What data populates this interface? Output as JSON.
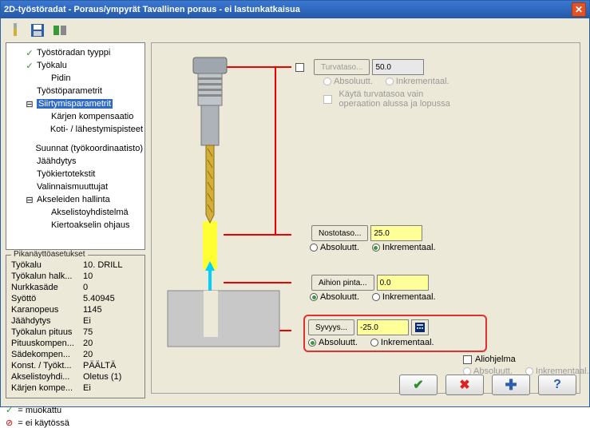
{
  "title": "2D-työstöradat - Poraus/ympyrät Tavallinen poraus - ei lastunkatkaisua",
  "tree": {
    "items": [
      {
        "label": "Työstöradan tyyppi",
        "mark": "green",
        "indent": 1
      },
      {
        "label": "Työkalu",
        "mark": "green",
        "indent": 1
      },
      {
        "label": "Pidin",
        "mark": "",
        "indent": 2
      },
      {
        "label": "Työstöparametrit",
        "mark": "",
        "indent": 1
      },
      {
        "label": "Siirtymisparametrit",
        "mark": "",
        "indent": 1,
        "sel": true
      },
      {
        "label": "Kärjen kompensaatio",
        "mark": "",
        "indent": 2
      },
      {
        "label": "Koti- / lähestymispisteet",
        "mark": "",
        "indent": 2
      },
      {
        "label": "Suunnat (työkoordinaatisto)",
        "mark": "",
        "indent": 1
      },
      {
        "label": "Jäähdytys",
        "mark": "",
        "indent": 1
      },
      {
        "label": "Työkiertotekstit",
        "mark": "",
        "indent": 1
      },
      {
        "label": "Valinnaismuuttujat",
        "mark": "",
        "indent": 1
      },
      {
        "label": "Akseleiden hallinta",
        "mark": "",
        "indent": 1
      },
      {
        "label": "Akselistoyhdistelmä",
        "mark": "",
        "indent": 2
      },
      {
        "label": "Kiertoakselin ohjaus",
        "mark": "",
        "indent": 2
      }
    ]
  },
  "quick": {
    "title": "Pikanäyttöasetukset",
    "rows": [
      {
        "l": "Työkalu",
        "v": "10. DRILL"
      },
      {
        "l": "Työkalun halk...",
        "v": "10"
      },
      {
        "l": "Nurkkasäde",
        "v": "0"
      },
      {
        "l": "Syöttö",
        "v": "5.40945"
      },
      {
        "l": "Karanopeus",
        "v": "1145"
      },
      {
        "l": "Jäähdytys",
        "v": "Ei"
      },
      {
        "l": "Työkalun pituus",
        "v": "75"
      },
      {
        "l": "Pituuskompen...",
        "v": "20"
      },
      {
        "l": "Sädekompen...",
        "v": "20"
      },
      {
        "l": "Konst. / Työkt...",
        "v": "PÄÄLTÄ"
      },
      {
        "l": "Akselistoyhdi...",
        "v": "Oletus (1)"
      },
      {
        "l": "Kärjen kompe...",
        "v": "Ei"
      }
    ]
  },
  "legend": {
    "edited": "= muokattu",
    "disabled": "= ei käytössä"
  },
  "params": {
    "clearance": {
      "btn": "Turvataso...",
      "val": "50.0",
      "abs": "Absoluutt.",
      "inc": "Inkrementaal.",
      "only": "Käytä turvatasoa vain operaation alussa ja lopussa"
    },
    "retract": {
      "btn": "Nostotaso...",
      "val": "25.0",
      "abs": "Absoluutt.",
      "inc": "Inkrementaal."
    },
    "top": {
      "btn": "Aihion pinta...",
      "val": "0.0",
      "abs": "Absoluutt.",
      "inc": "Inkrementaal."
    },
    "depth": {
      "btn": "Syvyys...",
      "val": "-25.0",
      "abs": "Absoluutt.",
      "inc": "Inkrementaal."
    },
    "sub": {
      "lbl": "Aliohjelma",
      "abs": "Absoluutt.",
      "inc": "Inkrementaal."
    }
  }
}
